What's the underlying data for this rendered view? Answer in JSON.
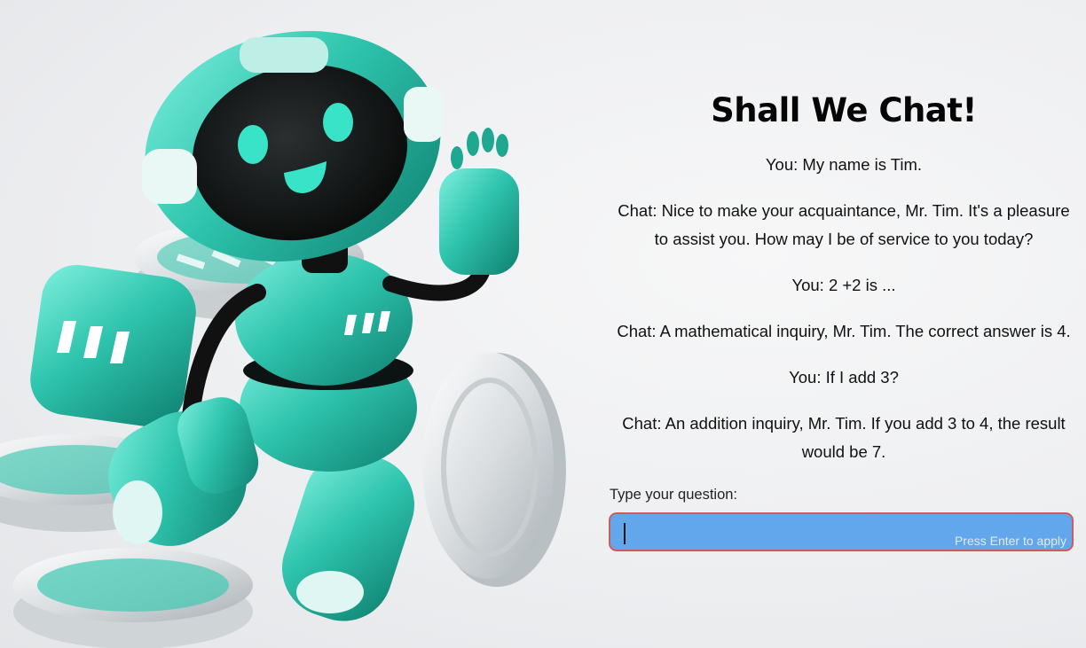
{
  "chat": {
    "title": "Shall We Chat!",
    "messages": [
      {
        "text": "You: My name is Tim."
      },
      {
        "text": "Chat: Nice to make your acquaintance, Mr. Tim. It's a pleasure to assist you. How may I be of service to you today?"
      },
      {
        "text": "You: 2 +2 is ..."
      },
      {
        "text": "Chat: A mathematical inquiry, Mr. Tim. The correct answer is 4."
      },
      {
        "text": "You: If I add 3?"
      },
      {
        "text": "Chat: An addition inquiry, Mr. Tim. If you add 3 to 4, the result would be 7."
      }
    ],
    "input": {
      "label": "Type your question:",
      "value": "",
      "hint": "Press Enter to apply"
    }
  },
  "colors": {
    "robot_teal": "#2ec4ad",
    "input_fill": "#62a6ec",
    "input_border": "#d15b5b"
  }
}
